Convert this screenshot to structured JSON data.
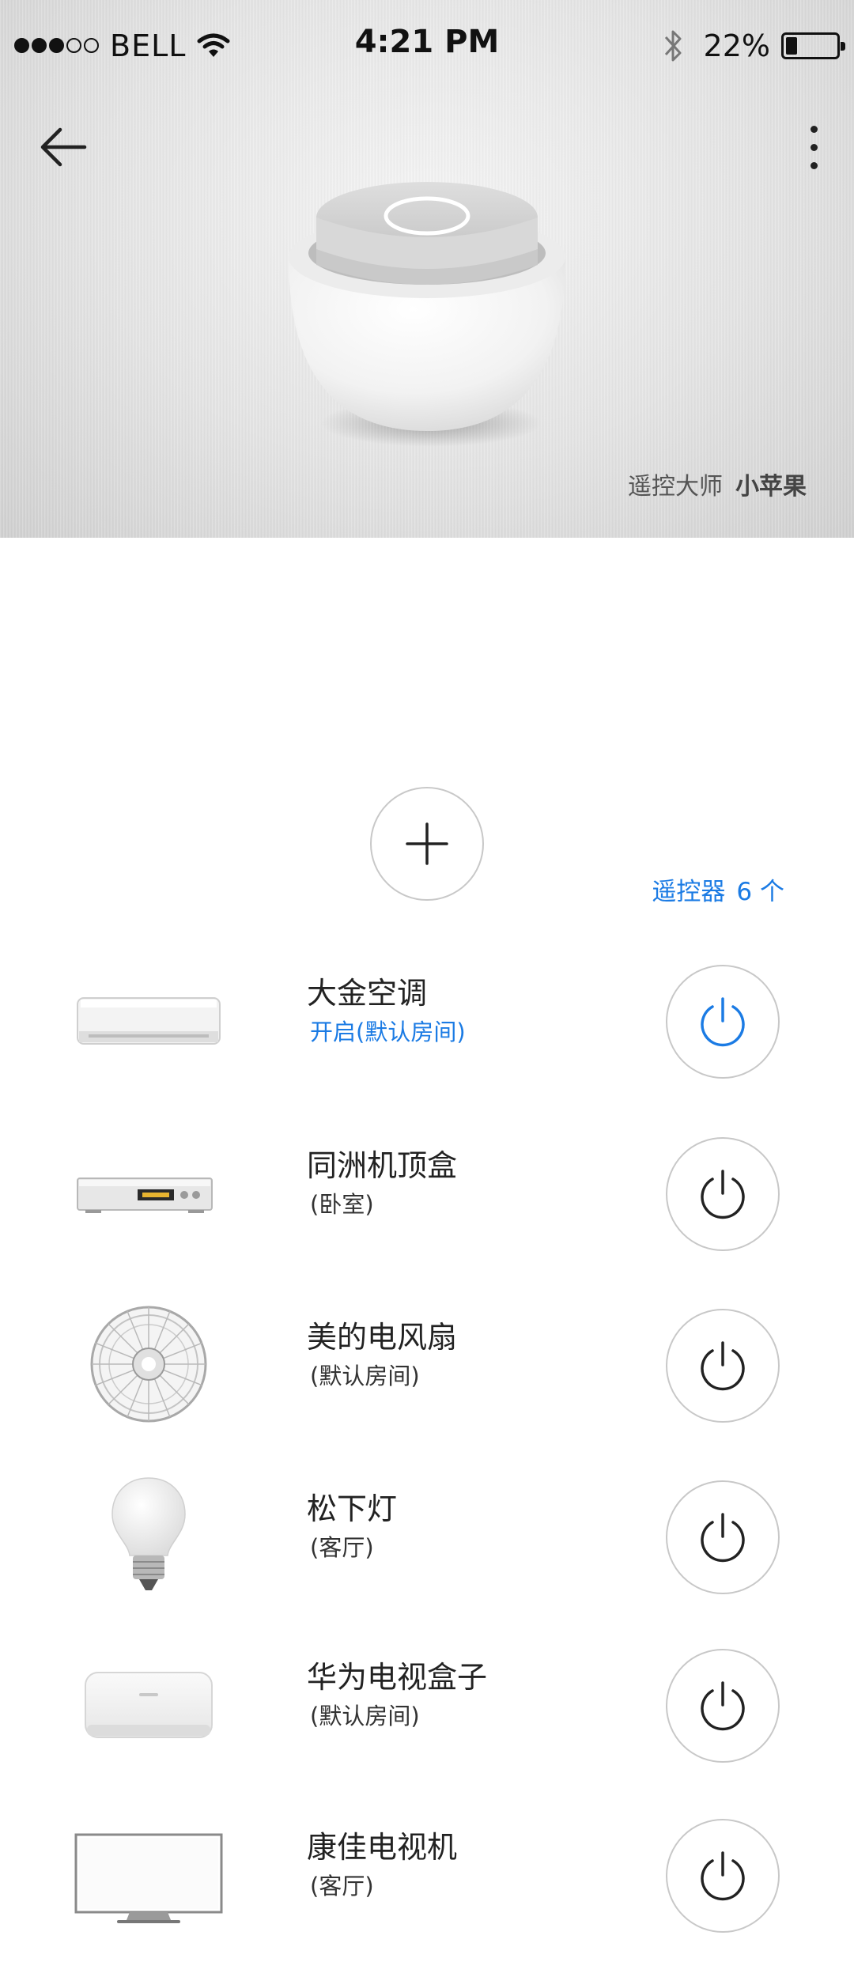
{
  "status_bar": {
    "carrier": "BELL",
    "time": "4:21 PM",
    "battery_percent": "22%",
    "battery_level": 0.22,
    "signal_bars_filled": 3,
    "signal_bars_total": 5
  },
  "header": {
    "back_icon": "arrow-left-icon",
    "menu_icon": "more-vertical-icon"
  },
  "hero": {
    "app_label": "遥控大师",
    "device_name": "小苹果"
  },
  "remote_count": {
    "label": "遥控器",
    "count": "6 个"
  },
  "accent_color": "#1b7be4",
  "devices": [
    {
      "name": "大金空调",
      "sub": "开启(默认房间)",
      "status": "on",
      "icon": "air-conditioner-icon"
    },
    {
      "name": "同洲机顶盒",
      "sub": "(卧室)",
      "status": "off",
      "icon": "set-top-box-icon"
    },
    {
      "name": "美的电风扇",
      "sub": "(默认房间)",
      "status": "off",
      "icon": "electric-fan-icon"
    },
    {
      "name": "松下灯",
      "sub": "(客厅)",
      "status": "off",
      "icon": "light-bulb-icon"
    },
    {
      "name": "华为电视盒子",
      "sub": "(默认房间)",
      "status": "off",
      "icon": "tv-box-icon"
    },
    {
      "name": "康佳电视机",
      "sub": "(客厅)",
      "status": "off",
      "icon": "television-icon"
    }
  ]
}
